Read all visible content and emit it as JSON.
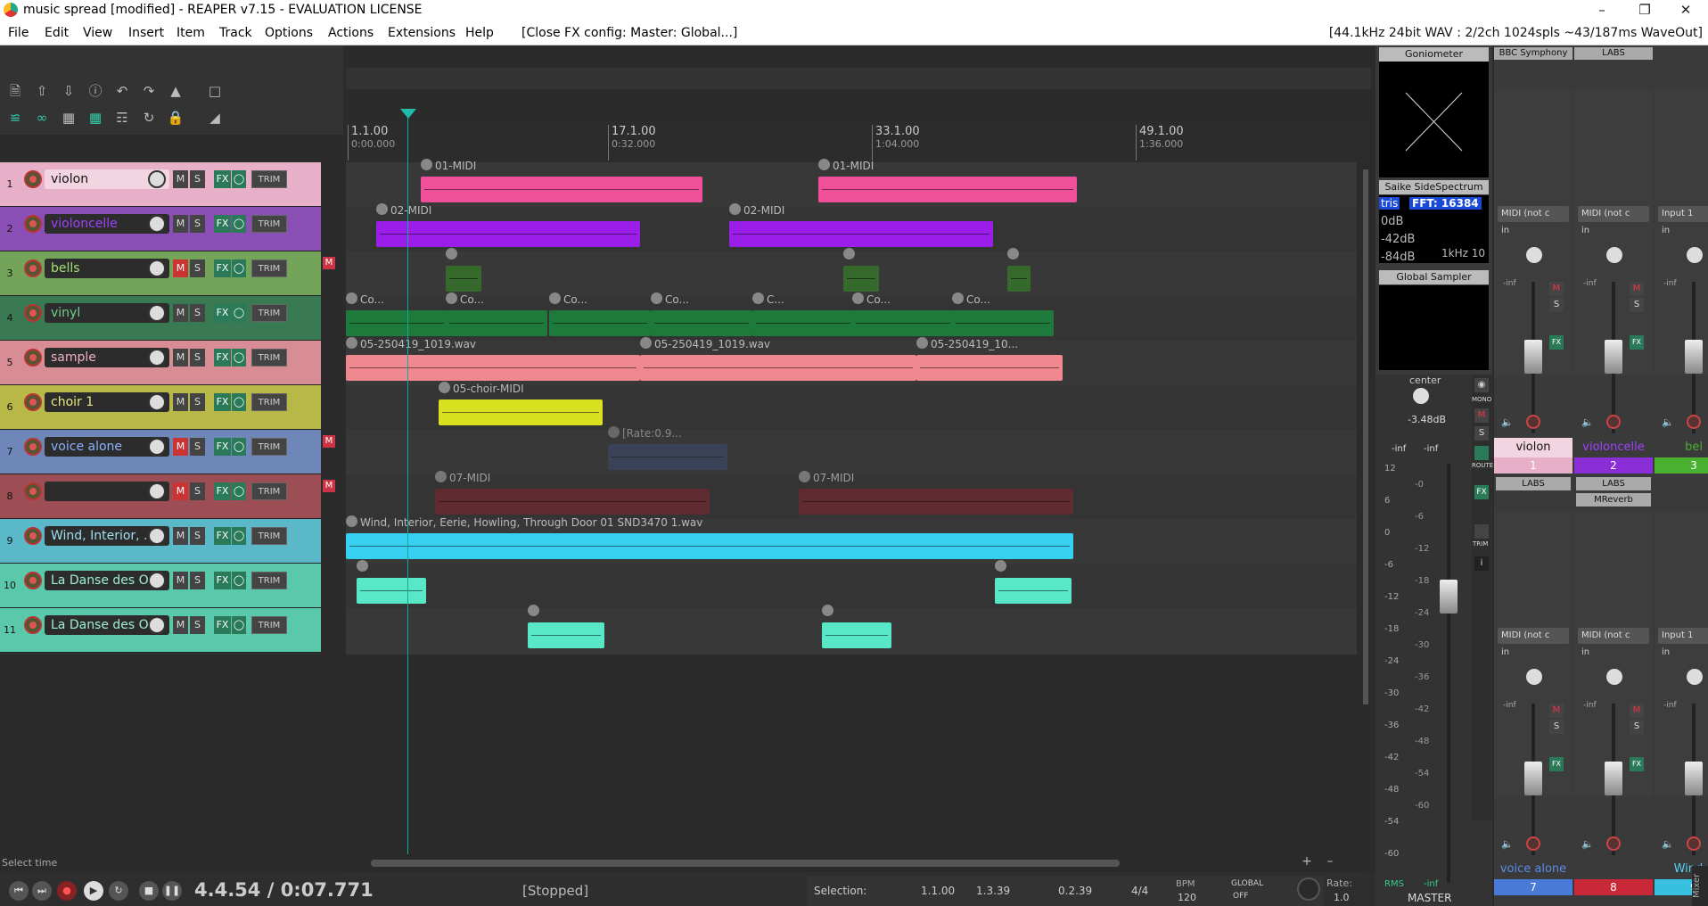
{
  "window": {
    "title": "music spread [modified] - REAPER v7.15 - EVALUATION LICENSE"
  },
  "menu": {
    "items": [
      "File",
      "Edit",
      "View",
      "Insert",
      "Item",
      "Track",
      "Options",
      "Actions",
      "Extensions",
      "Help"
    ],
    "action_label": "[Close FX config: Master: Global...]",
    "status": "[44.1kHz 24bit WAV : 2/2ch 1024spls ~43/187ms WaveOut]"
  },
  "ruler": {
    "marks": [
      {
        "bar": "1.1.00",
        "time": "0:00.000"
      },
      {
        "bar": "17.1.00",
        "time": "0:32.000"
      },
      {
        "bar": "33.1.00",
        "time": "1:04.000"
      },
      {
        "bar": "49.1.00",
        "time": "1:36.000"
      }
    ]
  },
  "tracks": [
    {
      "num": "1",
      "name": "violon",
      "color": "#e8b0c8",
      "muted": false
    },
    {
      "num": "2",
      "name": "violoncelle",
      "color": "#8a4fb5",
      "muted": false
    },
    {
      "num": "3",
      "name": "bells",
      "color": "#74a45a",
      "muted": true
    },
    {
      "num": "4",
      "name": "vinyl",
      "color": "#3a7a52",
      "muted": false
    },
    {
      "num": "5",
      "name": "sample",
      "color": "#d88c94",
      "muted": false
    },
    {
      "num": "6",
      "name": "choir 1",
      "color": "#b8b848",
      "muted": false
    },
    {
      "num": "7",
      "name": "voice alone",
      "color": "#6e86b8",
      "muted": true
    },
    {
      "num": "8",
      "name": "",
      "color": "#9c4e54",
      "muted": true
    },
    {
      "num": "9",
      "name": "Wind, Interior, ..1",
      "color": "#5ab8c8",
      "muted": false
    },
    {
      "num": "10",
      "name": "La Danse des Oml",
      "color": "#5ac8aa",
      "muted": false
    },
    {
      "num": "11",
      "name": "La Danse des Oml",
      "color": "#5ac8aa",
      "muted": false
    }
  ],
  "labels": {
    "m": "M",
    "s": "S",
    "fx": "FX",
    "trim": "TRIM",
    "i": "i"
  },
  "items": {
    "t1a": "01-MIDI",
    "t1b": "01-MIDI",
    "t2a": "02-MIDI",
    "t2b": "02-MIDI",
    "t4": [
      "Co...",
      "Co...",
      "Co...",
      "Co...",
      "C...",
      "Co...",
      "Co..."
    ],
    "t5a": "05-250419_1019.wav",
    "t5b": "05-250419_1019.wav",
    "t5c": "05-250419_10...",
    "t6": "05-choir-MIDI",
    "t7": "[Rate:0.9...",
    "t8a": "07-MIDI",
    "t8b": "07-MIDI",
    "t9": "Wind, Interior, Eerie, Howling, Through Door 01 SND3470 1.wav"
  },
  "fx_panel": {
    "goniometer": "Goniometer",
    "spectrum": "Saike SideSpectrum Mete",
    "spectrum_tris": "tris",
    "spectrum_fft": "FFT: 16384",
    "spectrum_db": [
      "0dB",
      "-42dB",
      "-84dB"
    ],
    "spectrum_khz": "1kHz 10",
    "sampler": "Global Sampler"
  },
  "master": {
    "pan": "center",
    "db": "-3.48dB",
    "inf_l": "-inf",
    "inf_r": "-inf",
    "scale": [
      "12",
      "6",
      "0",
      "-6",
      "-12",
      "-18",
      "-24",
      "-30",
      "-36",
      "-42",
      "-48",
      "-54",
      "-60"
    ],
    "scale_inner": [
      "-0",
      "-6",
      "-12",
      "-18",
      "-24",
      "-30",
      "-36",
      "-42",
      "-48",
      "-54",
      "-60"
    ],
    "mono": "MONO",
    "route": "ROUTE",
    "trim": "TRIM",
    "rms": "RMS",
    "rms_val": "-inf",
    "label": "MASTER"
  },
  "mixer": {
    "top_headers": [
      "BBC Symphony Or",
      "LABS"
    ],
    "strips_top": [
      {
        "name": "violon",
        "num": "1",
        "color": "#e8b0c8",
        "namecolor": "#111",
        "input": "MIDI (not c",
        "fx": [
          "LABS"
        ]
      },
      {
        "name": "violoncelle",
        "num": "2",
        "color": "#8a2ed8",
        "namecolor": "#a040ff",
        "input": "MIDI (not c",
        "fx": [
          "LABS",
          "MReverb"
        ]
      },
      {
        "name": "bel",
        "num": "3",
        "color": "#4ab030",
        "namecolor": "#4ab030",
        "input": "Input 1",
        "fx": []
      }
    ],
    "strips_bottom": [
      {
        "name": "voice alone",
        "num": "7",
        "color": "#4a7ad8",
        "namecolor": "#5a8ae8",
        "input": "MIDI (not c"
      },
      {
        "name": "",
        "num": "8",
        "color": "#c82838",
        "namecolor": "#c82838",
        "input": "MIDI (not c"
      },
      {
        "name": "Wind, I",
        "num": "9",
        "color": "#38c0e0",
        "namecolor": "#58d0f0",
        "input": "Input 1"
      }
    ],
    "in_label": "in",
    "inf": "-inf",
    "side_label": "Mixer"
  },
  "transport": {
    "position": "4.4.54 / 0:07.771",
    "state": "[Stopped]",
    "hint": "Select time",
    "selection_label": "Selection:",
    "sel_start": "1.1.00",
    "sel_end": "1.3.39",
    "sel_len": "0.2.39",
    "timesig": "4/4",
    "bpm_label": "BPM",
    "bpm": "120",
    "global_label": "GLOBAL",
    "global_val": "OFF",
    "rate_label": "Rate:",
    "rate": "1.0"
  }
}
